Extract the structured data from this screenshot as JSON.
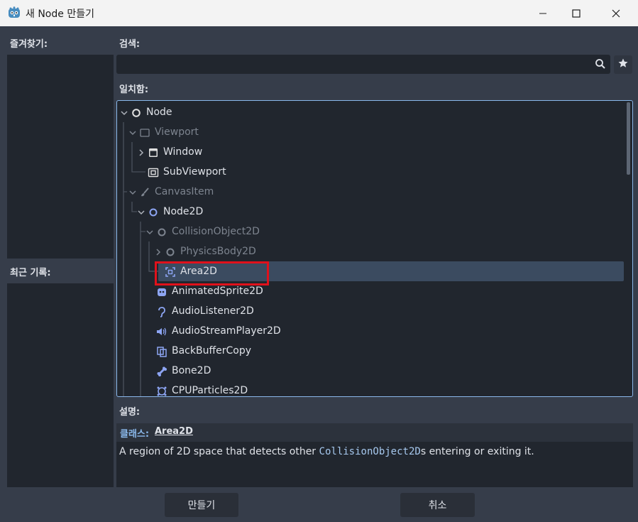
{
  "window": {
    "title": "새 Node 만들기"
  },
  "favorites": {
    "label": "즐겨찾기:"
  },
  "recent": {
    "label": "최근 기록:"
  },
  "search": {
    "label": "검색:",
    "value": ""
  },
  "matches": {
    "label": "일치함:"
  },
  "tree": {
    "items": [
      {
        "label": "Node",
        "icon": "node-circle-icon",
        "expanded": true,
        "dim": false
      },
      {
        "label": "Viewport",
        "icon": "viewport-icon",
        "expanded": true,
        "dim": true
      },
      {
        "label": "Window",
        "icon": "window-icon",
        "expanded": false,
        "dim": false
      },
      {
        "label": "SubViewport",
        "icon": "subviewport-icon",
        "dim": false
      },
      {
        "label": "CanvasItem",
        "icon": "brush-icon",
        "expanded": true,
        "dim": true
      },
      {
        "label": "Node2D",
        "icon": "node2d-circle-icon",
        "expanded": true,
        "dim": false
      },
      {
        "label": "CollisionObject2D",
        "icon": "node2d-circle-icon",
        "expanded": true,
        "dim": true
      },
      {
        "label": "PhysicsBody2D",
        "icon": "node2d-circle-icon",
        "expanded": false,
        "dim": true
      },
      {
        "label": "Area2D",
        "icon": "area2d-icon",
        "dim": false,
        "selected": true
      },
      {
        "label": "AnimatedSprite2D",
        "icon": "animated-sprite-icon",
        "dim": false
      },
      {
        "label": "AudioListener2D",
        "icon": "audio-listener-icon",
        "dim": false
      },
      {
        "label": "AudioStreamPlayer2D",
        "icon": "speaker-icon",
        "dim": false
      },
      {
        "label": "BackBufferCopy",
        "icon": "backbuffer-icon",
        "dim": false
      },
      {
        "label": "Bone2D",
        "icon": "bone-icon",
        "dim": false
      },
      {
        "label": "CPUParticles2D",
        "icon": "particles-icon",
        "dim": false
      }
    ]
  },
  "description": {
    "label": "설명:",
    "class_prefix": "클래스:",
    "class_name": "Area2D",
    "text_before": "A region of 2D space that detects other ",
    "code": "CollisionObject2D",
    "text_after": "s entering or exiting it."
  },
  "buttons": {
    "create": "만들기",
    "cancel": "취소"
  },
  "colors": {
    "accent": "#8ab8eb",
    "selection": "#3b4b60",
    "highlight_box": "#e0111b"
  }
}
